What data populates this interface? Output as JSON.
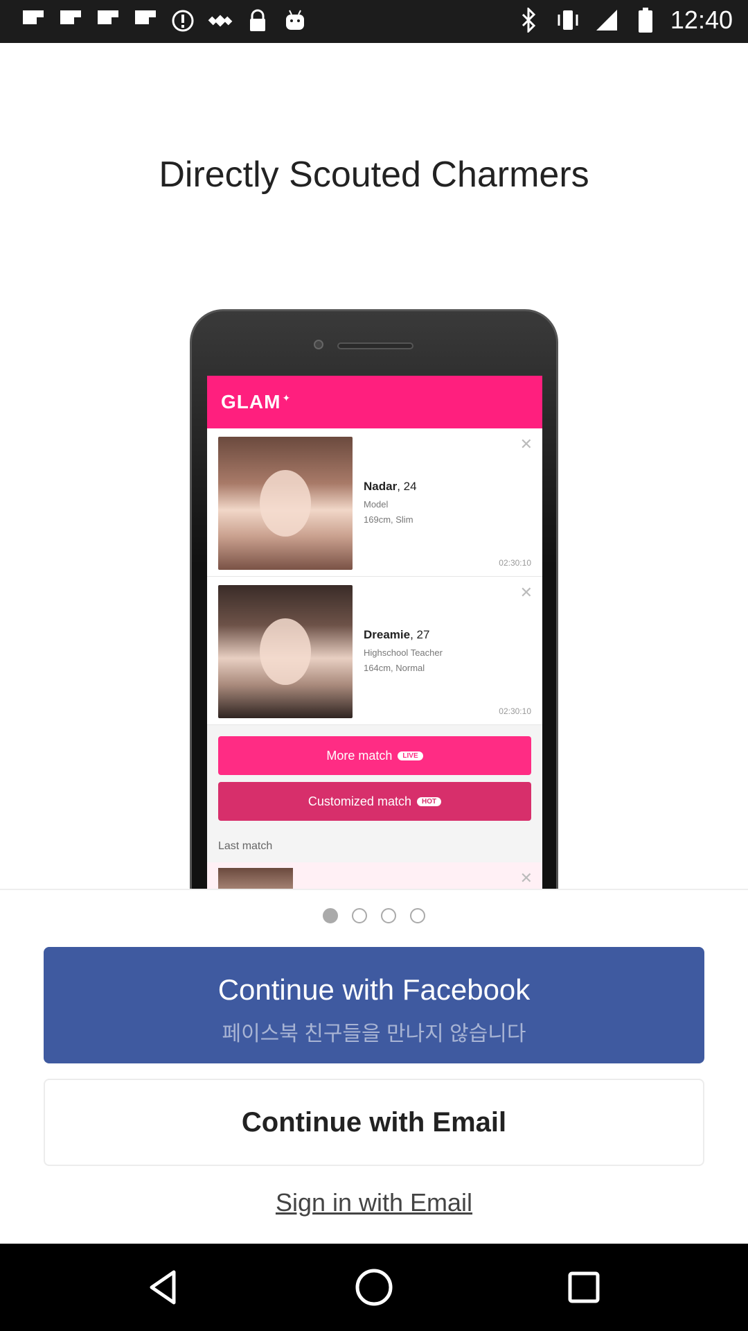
{
  "status_bar": {
    "time": "12:40",
    "left_icons": [
      "flipboard-icon",
      "flipboard-icon",
      "flipboard-icon",
      "flipboard-icon",
      "alert-icon",
      "fake-gps-icon",
      "lock-icon",
      "android-icon"
    ],
    "right_icons": [
      "bluetooth-icon",
      "vibrate-icon",
      "signal-icon",
      "battery-icon"
    ]
  },
  "title": "Directly Scouted Charmers",
  "mockup": {
    "app_name": "GLAM",
    "cards": [
      {
        "name": "Nadar",
        "age": ", 24",
        "job": "Model",
        "body": "169cm, Slim",
        "timer": "02:30:10"
      },
      {
        "name": "Dreamie",
        "age": ", 27",
        "job": "Highschool Teacher",
        "body": "164cm, Normal",
        "timer": "02:30:10"
      }
    ],
    "more_match": "More match",
    "live_badge": "LIVE",
    "customized_match": "Customized match",
    "hot_badge": "HOT",
    "last_match": "Last match"
  },
  "pager": {
    "count": 4,
    "active_index": 0
  },
  "buttons": {
    "facebook_label": "Continue with Facebook",
    "facebook_sub": "페이스북 친구들을 만나지 않습니다",
    "email_label": "Continue with Email",
    "signin_label": "Sign in with Email"
  },
  "colors": {
    "facebook": "#3f5aa0",
    "glam_pink": "#ff1f7e"
  }
}
